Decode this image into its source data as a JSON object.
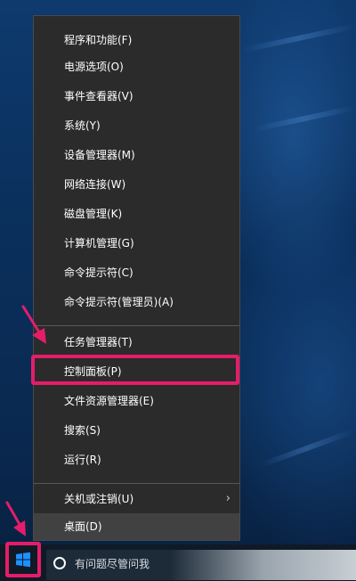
{
  "context_menu": {
    "groups": [
      {
        "items": [
          {
            "label": "程序和功能(F)"
          },
          {
            "label": "电源选项(O)"
          },
          {
            "label": "事件查看器(V)"
          },
          {
            "label": "系统(Y)"
          },
          {
            "label": "设备管理器(M)"
          },
          {
            "label": "网络连接(W)"
          },
          {
            "label": "磁盘管理(K)"
          },
          {
            "label": "计算机管理(G)"
          },
          {
            "label": "命令提示符(C)"
          },
          {
            "label": "命令提示符(管理员)(A)"
          }
        ]
      },
      {
        "items": [
          {
            "label": "任务管理器(T)"
          },
          {
            "label": "控制面板(P)",
            "highlighted": true
          },
          {
            "label": "文件资源管理器(E)"
          },
          {
            "label": "搜索(S)"
          },
          {
            "label": "运行(R)"
          }
        ]
      },
      {
        "items": [
          {
            "label": "关机或注销(U)",
            "has_submenu": true,
            "submenu_icon": "chevron-right-icon"
          },
          {
            "label": "桌面(D)",
            "hovered": true
          }
        ]
      }
    ]
  },
  "taskbar": {
    "start_icon": "windows-logo-icon",
    "search": {
      "icon": "cortana-icon",
      "placeholder": "有问题尽管问我"
    }
  },
  "annotations": {
    "highlight_color": "#e41d6a",
    "arrow_color": "#e41d6a"
  },
  "colors": {
    "menu_background": "#2b2b2b",
    "menu_hover": "#414141",
    "menu_text": "#ffffff",
    "taskbar": "#0f1a26",
    "windows_logo": "#1e90ff"
  }
}
